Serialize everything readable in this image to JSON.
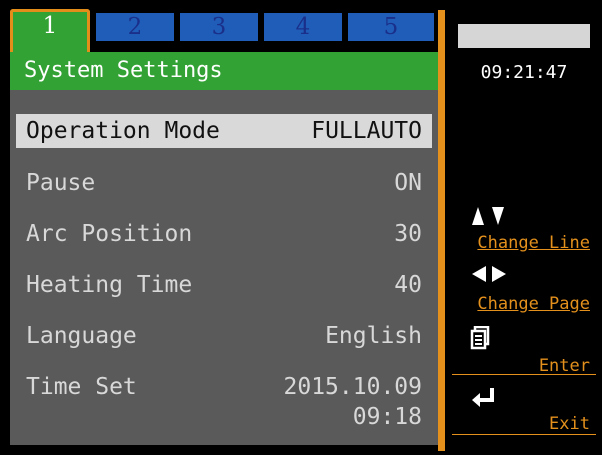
{
  "tabs": [
    "1",
    "2",
    "3",
    "4",
    "5"
  ],
  "title": "System Settings",
  "settings": [
    {
      "label": "Operation Mode",
      "value": "FULLAUTO"
    },
    {
      "label": "Pause",
      "value": "ON"
    },
    {
      "label": "Arc Position",
      "value": "30"
    },
    {
      "label": "Heating Time",
      "value": "40"
    },
    {
      "label": "Language",
      "value": "English"
    },
    {
      "label": "Time Set",
      "value": "2015.10.09",
      "value2": "09:18"
    }
  ],
  "clock": "09:21:47",
  "side": {
    "change_line": "Change Line",
    "change_page": "Change Page",
    "enter": "Enter",
    "exit": "Exit"
  },
  "icons": {
    "change_line": "up-down-triangles-icon",
    "change_page": "left-right-triangles-icon",
    "enter": "document-stack-icon",
    "exit": "return-arrow-icon"
  },
  "colors": {
    "green": "#33a235",
    "blue": "#1f5db8",
    "orange": "#e3901c",
    "panel": "#5a5a5a",
    "selected": "#d9d9d9"
  }
}
